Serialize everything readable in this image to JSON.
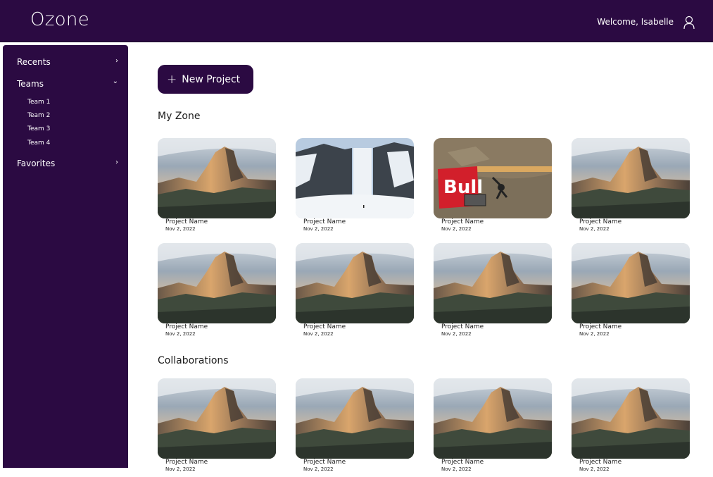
{
  "app": {
    "title": "Ozone",
    "welcome": "Welcome, Isabelle"
  },
  "sidebar": {
    "items": [
      {
        "label": "Recents"
      },
      {
        "label": "Teams"
      },
      {
        "label": "Favorites"
      }
    ],
    "teams": [
      "Team 1",
      "Team 2",
      "Team 3",
      "Team 4"
    ]
  },
  "actions": {
    "new_project": "New Project"
  },
  "sections": {
    "my_zone": "My Zone",
    "collaborations": "Collaborations"
  },
  "my_zone_projects": [
    {
      "name": "Project Name",
      "date": "Nov 2, 2022",
      "image": "mountain-dome"
    },
    {
      "name": "Project Name",
      "date": "Nov 2, 2022",
      "image": "waterfall"
    },
    {
      "name": "Project Name",
      "date": "Nov 2, 2022",
      "image": "skydive"
    },
    {
      "name": "Project Name",
      "date": "Nov 2, 2022",
      "image": "mountain-dome"
    },
    {
      "name": "Project Name",
      "date": "Nov 2, 2022",
      "image": "mountain-dome"
    },
    {
      "name": "Project Name",
      "date": "Nov 2, 2022",
      "image": "mountain-dome"
    },
    {
      "name": "Project Name",
      "date": "Nov 2, 2022",
      "image": "mountain-dome"
    },
    {
      "name": "Project Name",
      "date": "Nov 2, 2022",
      "image": "mountain-dome"
    }
  ],
  "collaboration_projects": [
    {
      "name": "Project Name",
      "date": "Nov 2, 2022",
      "image": "mountain-dome"
    },
    {
      "name": "Project Name",
      "date": "Nov 2, 2022",
      "image": "mountain-dome"
    },
    {
      "name": "Project Name",
      "date": "Nov 2, 2022",
      "image": "mountain-dome"
    },
    {
      "name": "Project Name",
      "date": "Nov 2, 2022",
      "image": "mountain-dome"
    }
  ],
  "colors": {
    "brand": "#2b0a42",
    "background": "#ffffff"
  }
}
